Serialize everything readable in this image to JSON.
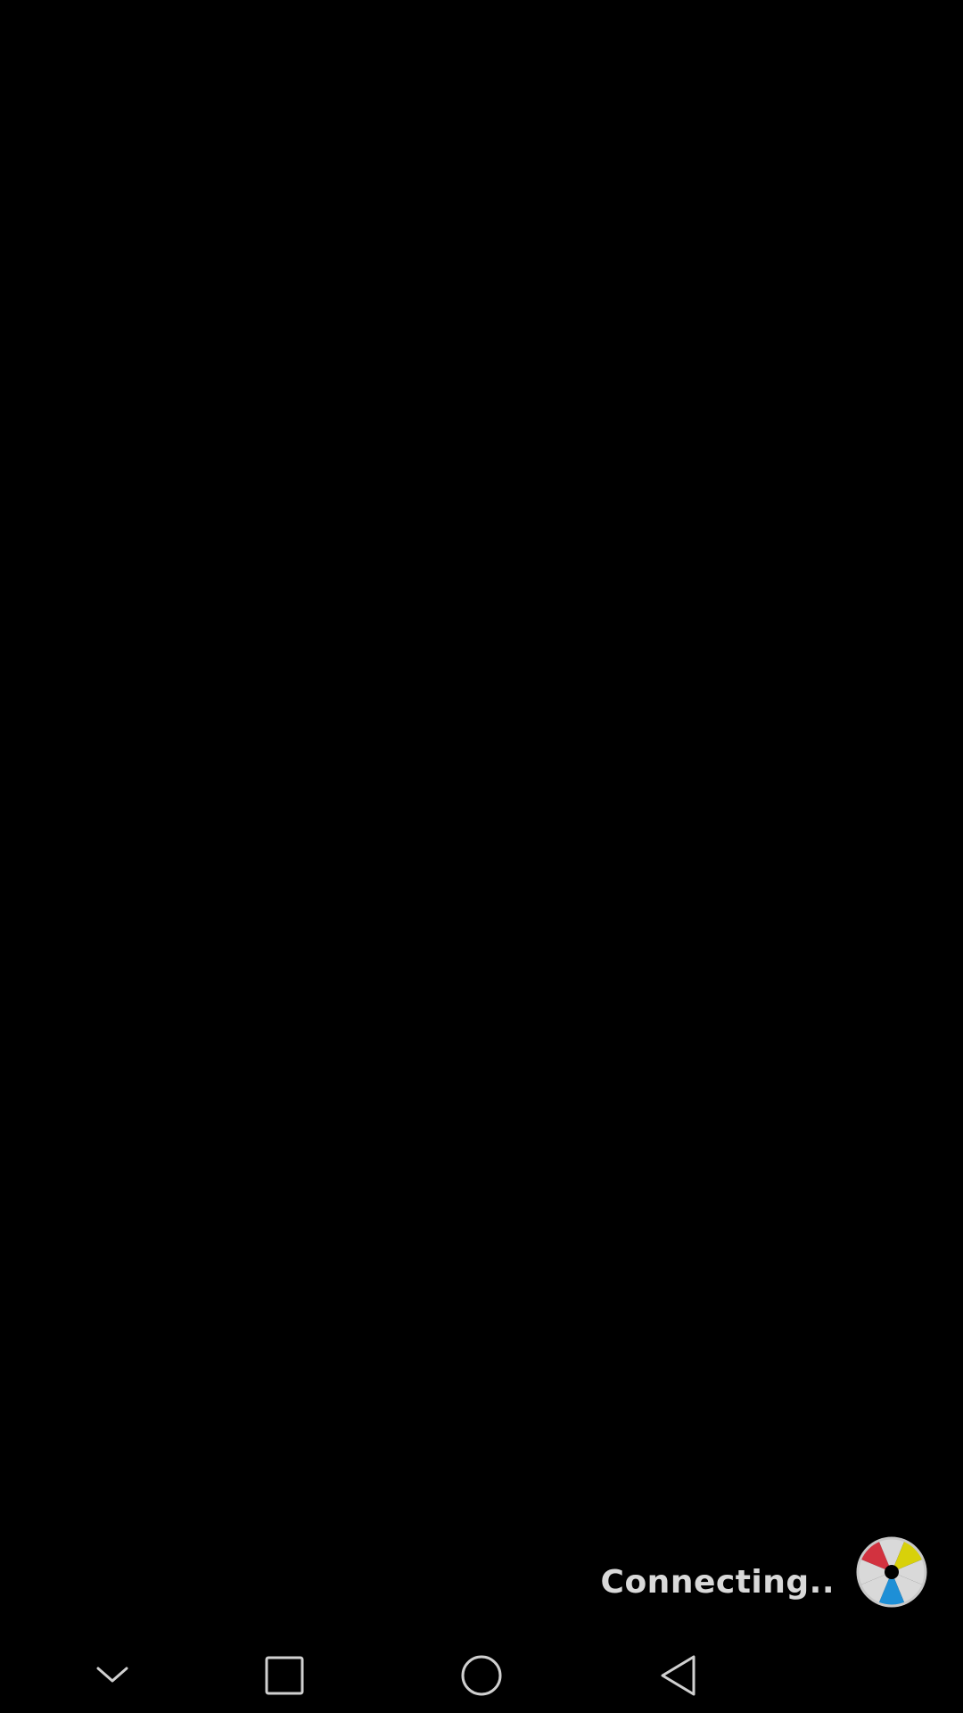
{
  "status": {
    "connecting_label": "Connecting.."
  },
  "spinner": {
    "colors": {
      "red": "#d2323f",
      "yellow": "#d8d10a",
      "blue": "#1e8fd6",
      "light": "#d9d9d9",
      "ring": "#c8c8c8",
      "hub": "#000000"
    }
  },
  "nav_bar": {
    "icon_color": "#d0d0d0",
    "buttons": [
      {
        "name": "hide-keyboard",
        "icon": "chevron-down-icon"
      },
      {
        "name": "recents",
        "icon": "square-icon"
      },
      {
        "name": "home",
        "icon": "circle-icon"
      },
      {
        "name": "back",
        "icon": "triangle-back-icon"
      }
    ]
  }
}
